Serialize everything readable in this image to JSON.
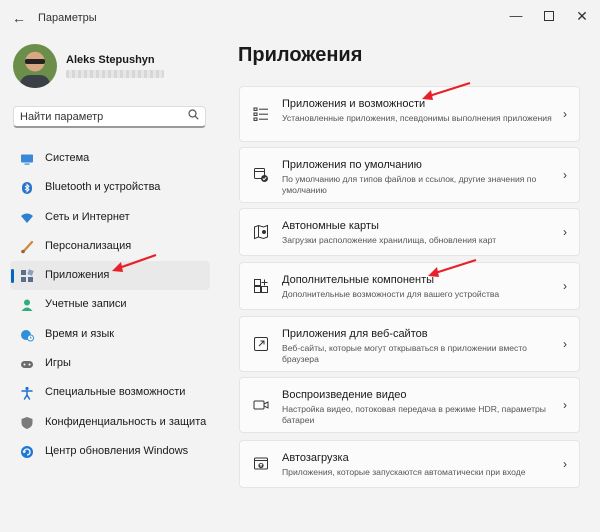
{
  "window": {
    "title": "Параметры"
  },
  "profile": {
    "name": "Aleks Stepushyn"
  },
  "search": {
    "placeholder": "Найти параметр"
  },
  "nav": [
    {
      "label": "Система",
      "icon": "monitor-icon",
      "color": "#3a88d8"
    },
    {
      "label": "Bluetooth и устройства",
      "icon": "bluetooth-icon",
      "color": "#2a74c9"
    },
    {
      "label": "Сеть и Интернет",
      "icon": "wifi-icon",
      "color": "#2f7fd0"
    },
    {
      "label": "Персонализация",
      "icon": "brush-icon",
      "color": "#d2853a"
    },
    {
      "label": "Приложения",
      "icon": "apps-icon",
      "color": "#5a6f8a",
      "selected": true
    },
    {
      "label": "Учетные записи",
      "icon": "person-icon",
      "color": "#2fae7a"
    },
    {
      "label": "Время и язык",
      "icon": "globe-clock-icon",
      "color": "#2f8fd8"
    },
    {
      "label": "Игры",
      "icon": "gamepad-icon",
      "color": "#6b6b6b"
    },
    {
      "label": "Специальные возможности",
      "icon": "accessibility-icon",
      "color": "#1f6fd0"
    },
    {
      "label": "Конфиденциальность и защита",
      "icon": "shield-icon",
      "color": "#7a7a7a"
    },
    {
      "label": "Центр обновления Windows",
      "icon": "update-icon",
      "color": "#1f78d1"
    }
  ],
  "main": {
    "title": "Приложения",
    "cards": [
      {
        "title": "Приложения и возможности",
        "desc": "Установленные приложения, псевдонимы выполнения приложения",
        "icon": "list-icon"
      },
      {
        "title": "Приложения по умолчанию",
        "desc": "По умолчанию для типов файлов и ссылок, другие значения по умолчанию",
        "icon": "default-apps-icon"
      },
      {
        "title": "Автономные карты",
        "desc": "Загрузки расположение хранилища, обновления карт",
        "icon": "map-icon"
      },
      {
        "title": "Дополнительные компоненты",
        "desc": "Дополнительные возможности для вашего устройства",
        "icon": "add-component-icon"
      },
      {
        "title": "Приложения для веб-сайтов",
        "desc": "Веб-сайты, которые могут открываться в приложении вместо браузера",
        "icon": "open-external-icon"
      },
      {
        "title": "Воспроизведение видео",
        "desc": "Настройка видео, потоковая передача в режиме HDR, параметры батареи",
        "icon": "video-icon"
      },
      {
        "title": "Автозагрузка",
        "desc": "Приложения, которые запускаются автоматически при входе",
        "icon": "startup-icon"
      }
    ]
  },
  "annotation_color": "#e8202a"
}
